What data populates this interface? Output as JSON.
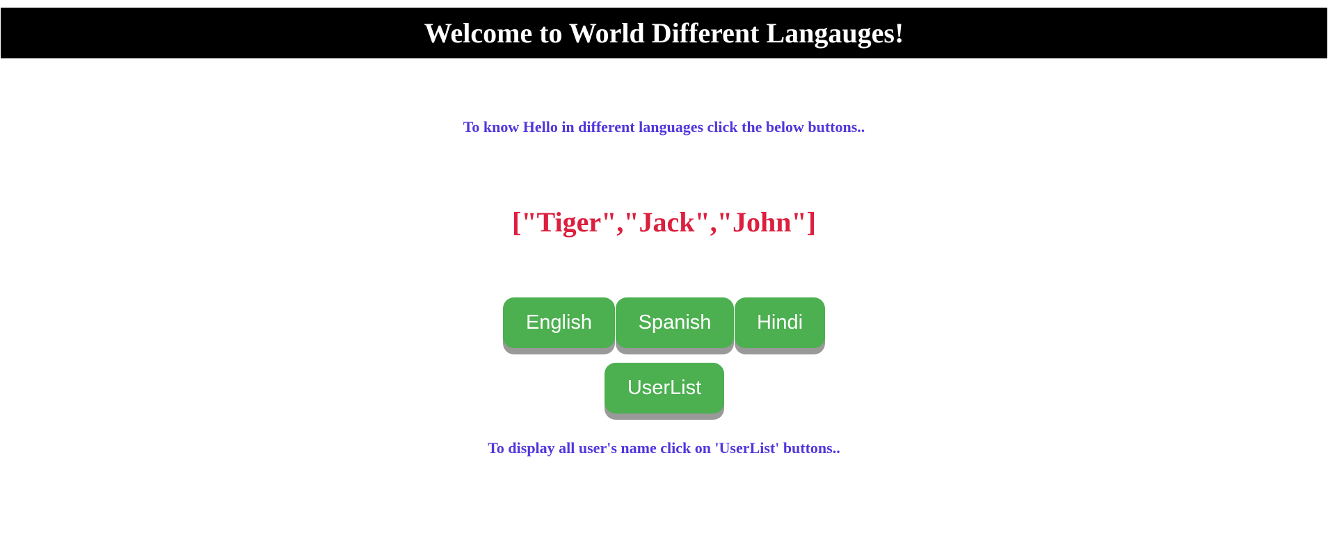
{
  "header": {
    "title": "Welcome to World Different Langauges!"
  },
  "intro_text": "To know Hello in different languages click the below buttons..",
  "result_text": "[\"Tiger\",\"Jack\",\"John\"]",
  "buttons": {
    "english": "English",
    "spanish": "Spanish",
    "hindi": "Hindi",
    "userlist": "UserList"
  },
  "footer_text": "To display all user's name click on 'UserList' buttons..",
  "colors": {
    "header_bg": "#000000",
    "button_bg": "#4caf50",
    "button_shadow": "#999999",
    "instruction_text": "#5137dd",
    "result_text": "#dc1f3e"
  }
}
